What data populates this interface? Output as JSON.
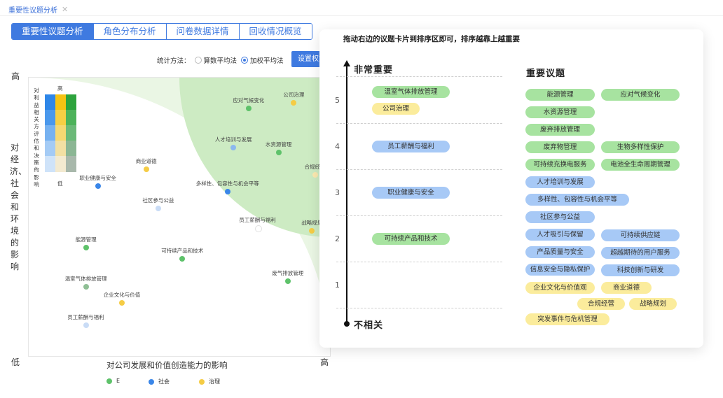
{
  "top_tab": {
    "label": "重要性议题分析",
    "close": "✕"
  },
  "tabs": [
    {
      "label": "重要性议题分析",
      "active": true
    },
    {
      "label": "角色分布分析",
      "active": false
    },
    {
      "label": "问卷数据详情",
      "active": false
    },
    {
      "label": "回收情况概览",
      "active": false
    }
  ],
  "stat_method": {
    "label": "统计方法：",
    "options": [
      {
        "label": "算数平均法",
        "selected": false
      },
      {
        "label": "加权平均法",
        "selected": true
      }
    ]
  },
  "settings_button": "设置权重",
  "chart_data": {
    "type": "scatter",
    "y_high": "高",
    "y_low": "低",
    "x_high": "高",
    "ylabel": "对经济、社会和环境的影响",
    "xlabel": "对公司发展和价值创造能力的影响",
    "colors": {
      "E": "#5ec26a",
      "社会": "#3a86e8",
      "治理": "#f5cc45"
    },
    "legend": [
      {
        "name": "E",
        "color": "#5ec26a"
      },
      {
        "name": "社会",
        "color": "#3a86e8"
      },
      {
        "name": "治理",
        "color": "#f5cc45"
      }
    ],
    "points": [
      {
        "label": "应对气候变化",
        "x": 0.73,
        "y": 0.89,
        "color": "#5ec26a"
      },
      {
        "label": "公司治理",
        "x": 0.88,
        "y": 0.91,
        "color": "#f5cc45"
      },
      {
        "label": "人才培训与发展",
        "x": 0.68,
        "y": 0.75,
        "color": "#8bb8ef"
      },
      {
        "label": "水资源管理",
        "x": 0.83,
        "y": 0.73,
        "color": "#5ec26a"
      },
      {
        "label": "商业道德",
        "x": 0.39,
        "y": 0.67,
        "color": "#f5cc45"
      },
      {
        "label": "职业健康与安全",
        "x": 0.23,
        "y": 0.61,
        "color": "#3a86e8"
      },
      {
        "label": "多样性、包容性与机会平等",
        "x": 0.66,
        "y": 0.59,
        "color": "#3a86e8"
      },
      {
        "label": "社区参与公益",
        "x": 0.43,
        "y": 0.53,
        "color": "#c9dcf6"
      },
      {
        "label": "员工薪酬与福利",
        "x": 0.76,
        "y": 0.46,
        "color": "#ffffff"
      },
      {
        "label": "战略规划",
        "x": 0.94,
        "y": 0.45,
        "color": "#f5cc45"
      },
      {
        "label": "合规经营",
        "x": 0.95,
        "y": 0.65,
        "color": "#fbe9b0"
      },
      {
        "label": "能源管理",
        "x": 0.19,
        "y": 0.39,
        "color": "#5ec26a"
      },
      {
        "label": "可持续产品和技术",
        "x": 0.51,
        "y": 0.35,
        "color": "#5ec26a"
      },
      {
        "label": "温室气体排放管理",
        "x": 0.19,
        "y": 0.25,
        "color": "#8fbf95"
      },
      {
        "label": "废气排放管理",
        "x": 0.86,
        "y": 0.27,
        "color": "#5ec26a"
      },
      {
        "label": "企业文化与价值",
        "x": 0.31,
        "y": 0.19,
        "color": "#f5cc45"
      },
      {
        "label": "员工薪酬与福利",
        "x": 0.19,
        "y": 0.11,
        "color": "#c9dcf6"
      }
    ],
    "heatmap_legend": {
      "title": "对利益相关方评估和决策的影响",
      "high": "高",
      "low": "低"
    }
  },
  "ranking": {
    "instruction": "拖动右边的议题卡片到排序区即可，排序越靠上越重要",
    "top_label": "非常重要",
    "bottom_label": "不相关",
    "rows": [
      {
        "num": "5",
        "items": [
          {
            "label": "温室气体排放管理",
            "color": "g"
          },
          {
            "label": "公司治理",
            "color": "y"
          }
        ]
      },
      {
        "num": "4",
        "items": [
          {
            "label": "员工薪酬与福利",
            "color": "b"
          }
        ]
      },
      {
        "num": "3",
        "items": [
          {
            "label": "职业健康与安全",
            "color": "b"
          }
        ]
      },
      {
        "num": "2",
        "items": [
          {
            "label": "可持续产品和技术",
            "color": "g"
          }
        ]
      },
      {
        "num": "1",
        "items": []
      }
    ]
  },
  "issues": {
    "title": "重要议题",
    "items": [
      {
        "label": "能源管理",
        "color": "g"
      },
      {
        "label": "应对气候变化",
        "color": "g"
      },
      {
        "label": "水资源管理",
        "color": "g"
      },
      {
        "label": "废弃排放管理",
        "color": "g"
      },
      {
        "label": "废弃物管理",
        "color": "g"
      },
      {
        "label": "生物多样性保护",
        "color": "g"
      },
      {
        "label": "可持续充换电服务",
        "color": "g"
      },
      {
        "label": "电池全生命周期管理",
        "color": "g"
      },
      {
        "label": "人才培训与发展",
        "color": "b"
      },
      {
        "label": "多样性、包容性与机会平等",
        "color": "b"
      },
      {
        "label": "社区参与公益",
        "color": "b"
      },
      {
        "label": "人才吸引与保留",
        "color": "b"
      },
      {
        "label": "可持续供应链",
        "color": "b"
      },
      {
        "label": "产品质量与安全",
        "color": "b"
      },
      {
        "label": "超越期待的用户服务",
        "color": "b"
      },
      {
        "label": "信息安全与隐私保护",
        "color": "b"
      },
      {
        "label": "科技创新与研发",
        "color": "b"
      },
      {
        "label": "企业文化与价值观",
        "color": "y"
      },
      {
        "label": "商业道德",
        "color": "y"
      },
      {
        "label": "合规经营",
        "color": "y"
      },
      {
        "label": "战略规划",
        "color": "y"
      },
      {
        "label": "突发事件与危机管理",
        "color": "y"
      }
    ]
  }
}
